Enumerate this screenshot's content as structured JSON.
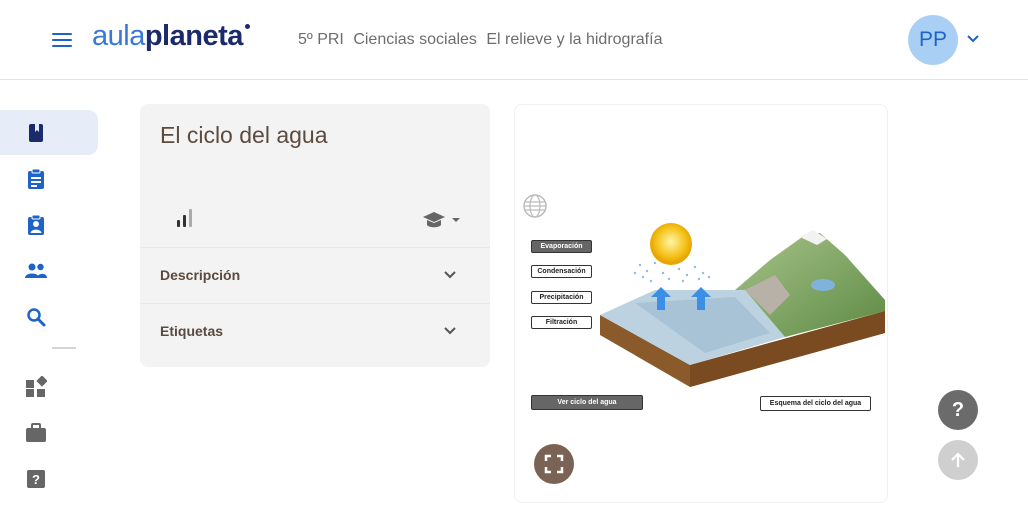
{
  "header": {
    "logo_part1": "aula",
    "logo_part2": "planeta",
    "breadcrumb": [
      "5º PRI",
      "Ciencias sociales",
      "El relieve y la hidrografía"
    ],
    "avatar_initials": "PP"
  },
  "sidebar": {
    "items": [
      {
        "icon": "book-icon",
        "active": true
      },
      {
        "icon": "clipboard-icon"
      },
      {
        "icon": "assignment-person-icon"
      },
      {
        "icon": "people-icon"
      },
      {
        "icon": "search-icon"
      },
      {
        "icon": "widgets-icon"
      },
      {
        "icon": "briefcase-icon"
      },
      {
        "icon": "help-square-icon"
      }
    ],
    "active_color": "#1b2a6b"
  },
  "card": {
    "title": "El ciclo del agua",
    "accordions": [
      {
        "label": "Descripción"
      },
      {
        "label": "Etiquetas"
      }
    ]
  },
  "media": {
    "buttons": {
      "evaporacion": "Evaporación",
      "condensacion": "Condensación",
      "precipitacion": "Precipitación",
      "filtracion": "Filtración",
      "ver_ciclo": "Ver ciclo del agua",
      "esquema": "Esquema del ciclo del agua"
    }
  },
  "fab": {
    "help_label": "?"
  },
  "colors": {
    "brand_light": "#3a78d8",
    "brand_dark": "#1b2a6b",
    "icon_blue": "#1e63c7",
    "avatar_bg": "#a9cff5",
    "card_bg": "#f3f3f3"
  }
}
